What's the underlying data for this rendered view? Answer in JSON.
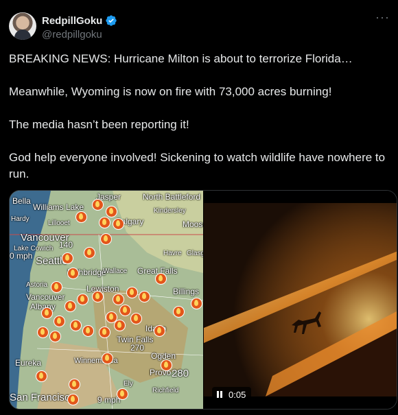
{
  "author": {
    "display_name": "RedpillGoku",
    "handle": "@redpillgoku",
    "verified": true
  },
  "tweet": {
    "paragraphs": [
      "BREAKING NEWS: Hurricane Milton is about to terrorize Florida…",
      "Meanwhile, Wyoming is now on fire with 73,000 acres burning!",
      "The media hasn’t been reporting it!",
      "God help everyone involved! Sickening to watch wildlife have nowhere to run."
    ]
  },
  "map": {
    "labels": [
      "Bella",
      "Williams Lake",
      "Jasper",
      "North Battleford",
      "Kindersley",
      "Hardy",
      "Lillooet",
      "Calgary",
      "Moose",
      "Vancouver",
      "140",
      "Lake Cowich",
      "0 mph",
      "Seattle",
      "Lethbridge",
      "Havre",
      "Glasgow",
      "Wallace",
      "Great Falls",
      "Astoria",
      "Vancouver",
      "Albany",
      "Lewiston",
      "Billings",
      "Idaho",
      "Twin Falls",
      "270",
      "Eureka",
      "Winnemucca",
      "Ogden",
      "Provo",
      "280",
      "Ely",
      "Richfield",
      "San Francisco",
      "9 mph"
    ]
  },
  "video": {
    "time": "0:05"
  },
  "colors": {
    "background": "#000000",
    "text": "#e7e9ea",
    "muted": "#71767b",
    "verified": "#1d9bf0",
    "fire": "#e2561a"
  }
}
